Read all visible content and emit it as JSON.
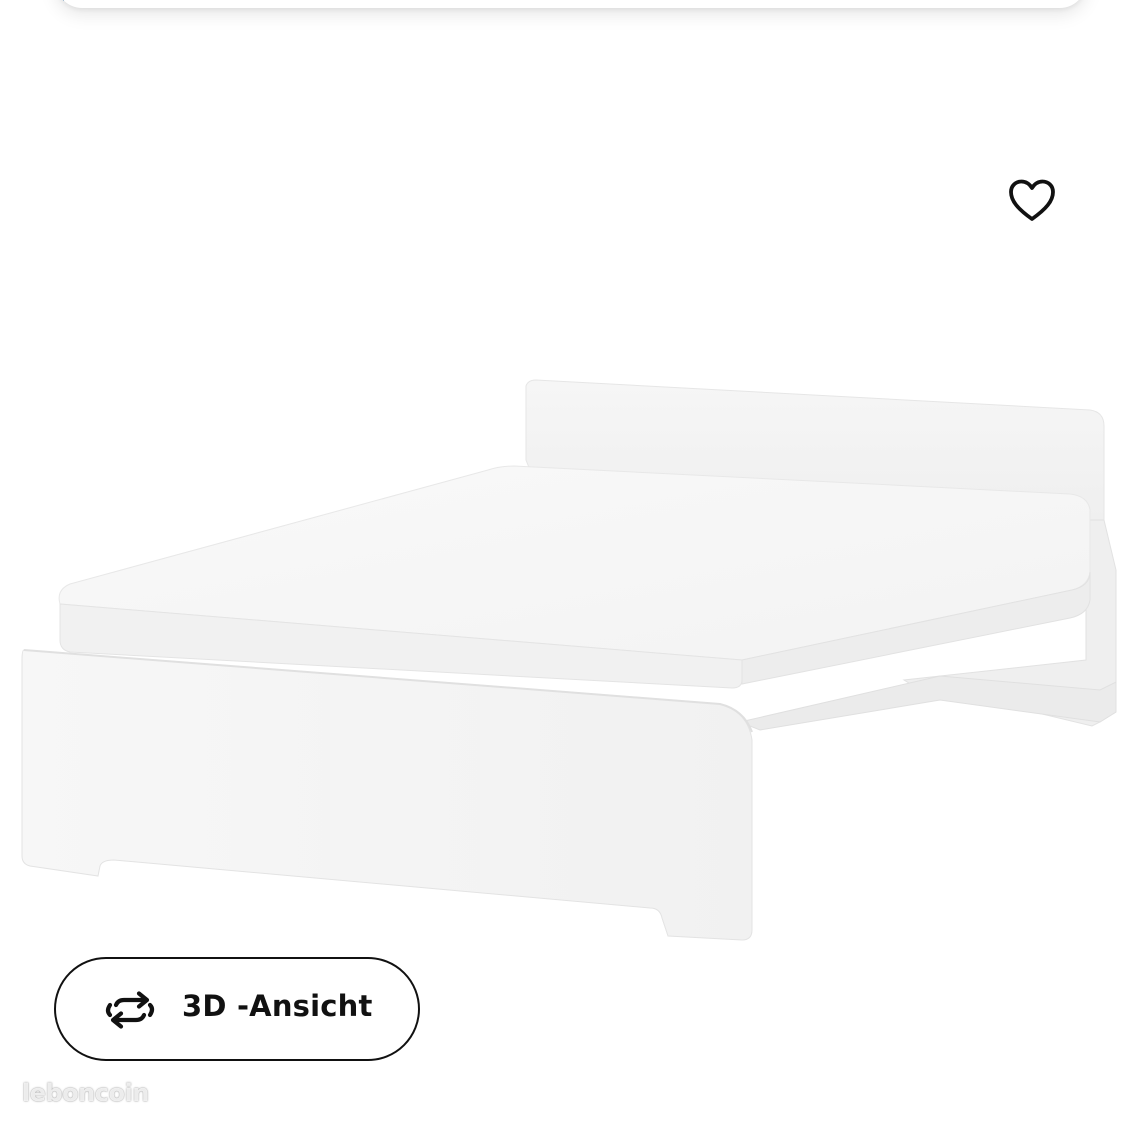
{
  "header": {
    "accent_color": "#0058a3"
  },
  "favorite": {
    "icon": "heart-outline-icon"
  },
  "product": {
    "image": "white-double-bed-with-mattress"
  },
  "view_3d": {
    "icon": "rotate-arrows-icon",
    "label": "3D -Ansicht"
  },
  "watermark": {
    "text": "leboncoin"
  }
}
